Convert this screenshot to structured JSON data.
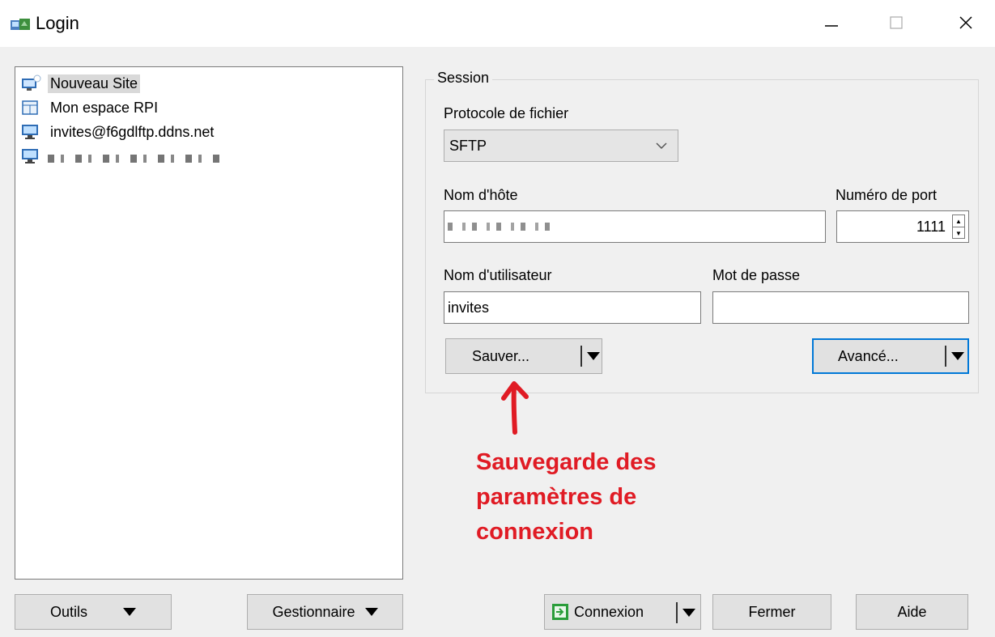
{
  "window": {
    "title": "Login",
    "controls": [
      "minimize-icon",
      "maximize-icon",
      "close-icon"
    ]
  },
  "sites": [
    {
      "label": "Nouveau Site",
      "icon": "new-site-icon",
      "selected": true
    },
    {
      "label": "Mon espace  RPI",
      "icon": "folder-site-icon",
      "selected": false
    },
    {
      "label": "invites@f6gdlftp.ddns.net",
      "icon": "monitor-icon",
      "selected": false
    }
  ],
  "session": {
    "group_label": "Session",
    "protocol_label": "Protocole de fichier",
    "protocol_value": "SFTP",
    "host_label": "Nom d'hôte",
    "port_label": "Numéro de port",
    "port_value": "1111",
    "user_label": "Nom d'utilisateur",
    "user_value": "invites",
    "password_label": "Mot de passe",
    "password_value": "",
    "save_label": "Sauver...",
    "advanced_label": "Avancé..."
  },
  "annotation": {
    "line1": "Sauvegarde des",
    "line2": "paramètres de",
    "line3": "connexion",
    "color": "#e01b24"
  },
  "footer": {
    "tools_label": "Outils",
    "manager_label": "Gestionnaire",
    "connect_label": "Connexion",
    "close_label": "Fermer",
    "help_label": "Aide"
  }
}
